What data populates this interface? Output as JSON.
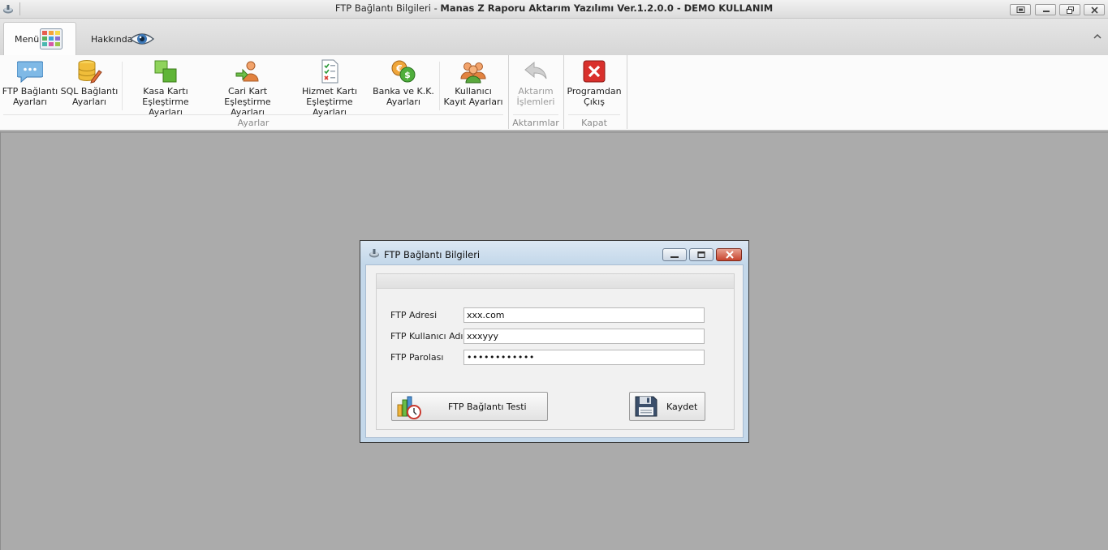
{
  "window": {
    "title_prefix": "FTP Bağlantı Bilgileri - ",
    "title_main": "Manas Z Raporu Aktarım Yazılımı Ver.1.2.0.0 - DEMO KULLANIM"
  },
  "tabs": {
    "menu": "Menü",
    "about": "Hakkında"
  },
  "ribbon": {
    "ftp_settings": [
      "FTP Bağlantı",
      "Ayarları"
    ],
    "sql_settings": [
      "SQL Bağlantı",
      "Ayarları"
    ],
    "cash_card": [
      "Kasa Kartı",
      "Eşleştirme Ayarları"
    ],
    "account_card": [
      "Cari Kart",
      "Eşleştirme Ayarları"
    ],
    "service_card": [
      "Hizmet Kartı",
      "Eşleştirme Ayarları"
    ],
    "bank_card": [
      "Banka ve K.K.",
      "Ayarları"
    ],
    "user_record": [
      "Kullanıcı",
      "Kayıt Ayarları"
    ],
    "transfer_ops": [
      "Aktarım",
      "İşlemleri"
    ],
    "exit": [
      "Programdan",
      "Çıkış"
    ],
    "group_settings": "Ayarlar",
    "group_transfers": "Aktarımlar",
    "group_close": "Kapat"
  },
  "dialog": {
    "title": "FTP Bağlantı Bilgileri",
    "fields": {
      "address_label": "FTP Adresi",
      "address_value": "xxx.com",
      "username_label": "FTP Kullanıcı Adı",
      "username_value": "xxxyyy",
      "password_label": "FTP Parolası",
      "password_value": "••••••••••••"
    },
    "test_button": "FTP Bağlantı Testi",
    "save_button": "Kaydet"
  },
  "colors": {
    "workspace": "#ababab",
    "dialog_frame": "#c4d8ea",
    "exit_red": "#d9302c"
  }
}
